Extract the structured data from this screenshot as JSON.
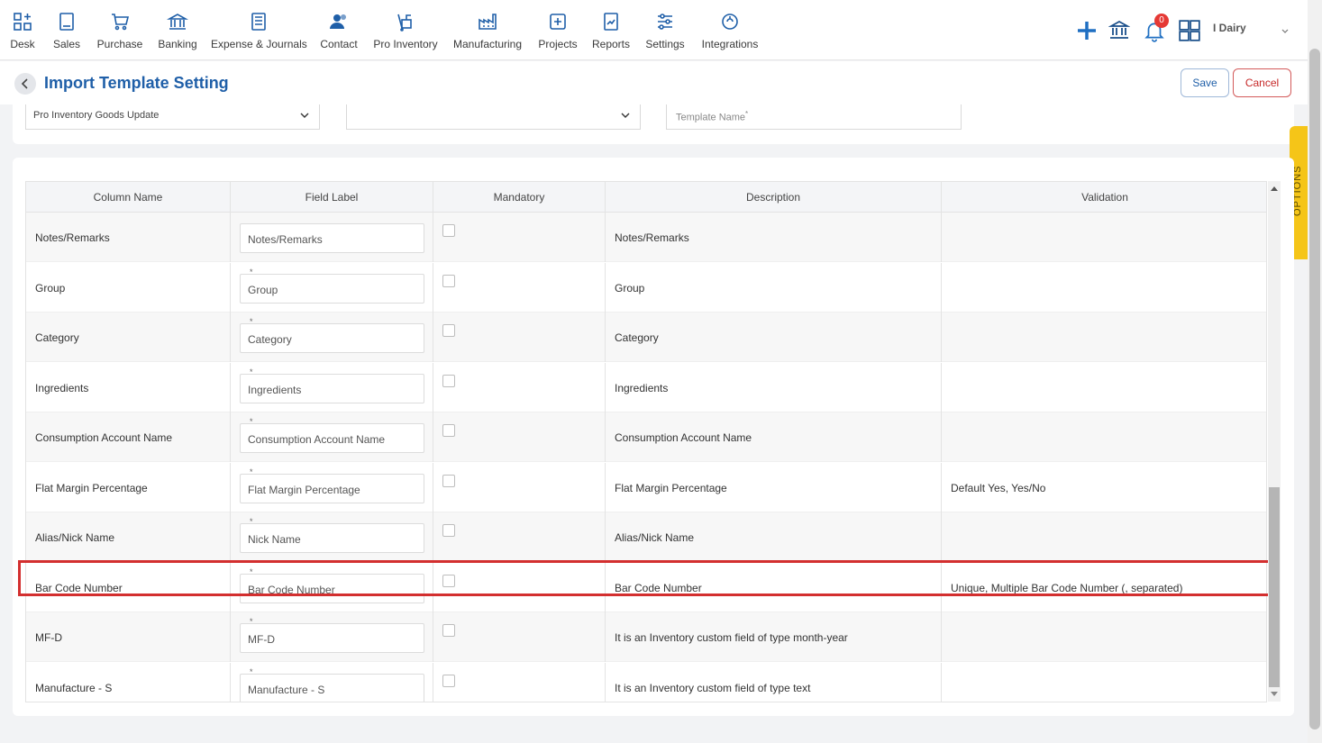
{
  "nav": {
    "items": [
      {
        "label": "Desk",
        "icon": "desk-icon"
      },
      {
        "label": "Sales",
        "icon": "sales-icon"
      },
      {
        "label": "Purchase",
        "icon": "cart-icon"
      },
      {
        "label": "Banking",
        "icon": "bank-icon"
      },
      {
        "label": "Expense & Journals",
        "icon": "journal-icon"
      },
      {
        "label": "Contact",
        "icon": "contact-icon"
      },
      {
        "label": "Pro Inventory",
        "icon": "inventory-icon"
      },
      {
        "label": "Manufacturing",
        "icon": "factory-icon"
      },
      {
        "label": "Projects",
        "icon": "projects-icon"
      },
      {
        "label": "Reports",
        "icon": "reports-icon"
      },
      {
        "label": "Settings",
        "icon": "settings-icon"
      },
      {
        "label": "Integrations",
        "icon": "integrations-icon"
      }
    ],
    "notification_count": "0",
    "org_name": "I Dairy"
  },
  "page": {
    "title": "Import Template Setting",
    "save_label": "Save",
    "cancel_label": "Cancel",
    "options_label": "OPTIONS"
  },
  "filters": {
    "type_selected": "Pro Inventory Goods Update",
    "second_selected": "",
    "template_name_placeholder": "Template Name",
    "required_marker": "*"
  },
  "table": {
    "headers": {
      "column_name": "Column Name",
      "field_label": "Field Label",
      "mandatory": "Mandatory",
      "description": "Description",
      "validation": "Validation"
    },
    "required_marker": "*",
    "rows": [
      {
        "column_name": "Notes/Remarks",
        "field_label": "Notes/Remarks",
        "mandatory": false,
        "description": "Notes/Remarks",
        "validation": ""
      },
      {
        "column_name": "Group",
        "field_label": "Group",
        "mandatory": false,
        "description": "Group",
        "validation": ""
      },
      {
        "column_name": "Category",
        "field_label": "Category",
        "mandatory": false,
        "description": "Category",
        "validation": ""
      },
      {
        "column_name": "Ingredients",
        "field_label": "Ingredients",
        "mandatory": false,
        "description": "Ingredients",
        "validation": ""
      },
      {
        "column_name": "Consumption Account Name",
        "field_label": "Consumption Account Name",
        "mandatory": false,
        "description": "Consumption Account Name",
        "validation": ""
      },
      {
        "column_name": "Flat Margin Percentage",
        "field_label": "Flat Margin Percentage",
        "mandatory": false,
        "description": "Flat Margin Percentage",
        "validation": "Default Yes, Yes/No"
      },
      {
        "column_name": "Alias/Nick Name",
        "field_label": "Nick Name",
        "mandatory": false,
        "description": "Alias/Nick Name",
        "validation": ""
      },
      {
        "column_name": "Bar Code Number",
        "field_label": "Bar Code Number",
        "mandatory": false,
        "description": "Bar Code Number",
        "validation": "Unique, Multiple Bar Code Number (, separated)"
      },
      {
        "column_name": "MF-D",
        "field_label": "MF-D",
        "mandatory": false,
        "description": "It is an Inventory custom field of type month-year",
        "validation": ""
      },
      {
        "column_name": "Manufacture - S",
        "field_label": "Manufacture - S",
        "mandatory": false,
        "description": "It is an Inventory custom field of type text",
        "validation": ""
      }
    ]
  },
  "colors": {
    "accent": "#1f5fa8",
    "cancel": "#c62828",
    "options_tab": "#f5c518",
    "highlight": "#d32f2f"
  }
}
